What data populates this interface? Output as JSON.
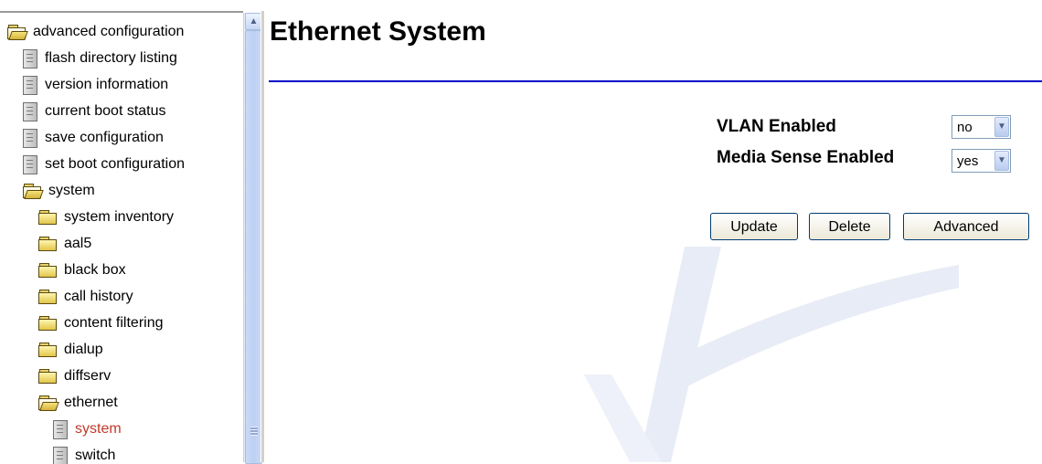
{
  "nav": {
    "items": [
      {
        "label": "advanced configuration",
        "icon": "open-folder-icon"
      },
      {
        "label": "flash directory listing",
        "icon": "document-icon"
      },
      {
        "label": "version information",
        "icon": "document-icon"
      },
      {
        "label": "current boot status",
        "icon": "document-icon"
      },
      {
        "label": "save configuration",
        "icon": "document-icon"
      },
      {
        "label": "set boot configuration",
        "icon": "document-icon"
      },
      {
        "label": "system",
        "icon": "open-folder-icon"
      },
      {
        "label": "system inventory",
        "icon": "folder-icon"
      },
      {
        "label": "aal5",
        "icon": "folder-icon"
      },
      {
        "label": "black box",
        "icon": "folder-icon"
      },
      {
        "label": "call history",
        "icon": "folder-icon"
      },
      {
        "label": "content filtering",
        "icon": "folder-icon"
      },
      {
        "label": "dialup",
        "icon": "folder-icon"
      },
      {
        "label": "diffserv",
        "icon": "folder-icon"
      },
      {
        "label": "ethernet",
        "icon": "open-folder-icon"
      },
      {
        "label": "system",
        "icon": "document-icon",
        "selected": true
      },
      {
        "label": "switch",
        "icon": "document-icon"
      }
    ]
  },
  "main": {
    "title": "Ethernet System",
    "fields": {
      "vlan": {
        "label": "VLAN Enabled",
        "value": "no"
      },
      "media_sense": {
        "label": "Media Sense Enabled",
        "value": "yes"
      }
    },
    "buttons": {
      "update": "Update",
      "delete": "Delete",
      "advanced": "Advanced"
    }
  },
  "colors": {
    "title_rule": "#0000cc",
    "selected_item": "#c0392b",
    "watermark": "#e8ecf6"
  }
}
